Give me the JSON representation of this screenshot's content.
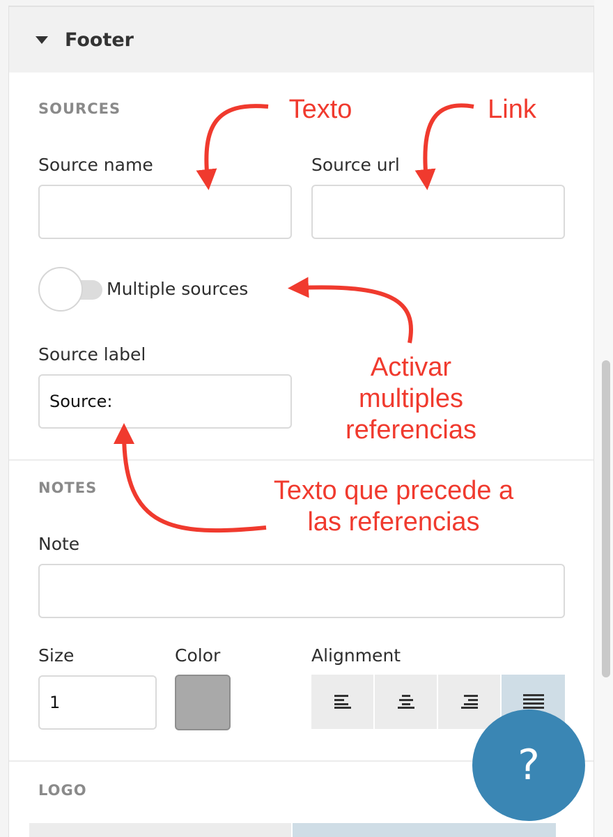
{
  "section": {
    "title": "Footer"
  },
  "sources": {
    "heading": "SOURCES",
    "source_name_label": "Source name",
    "source_name_value": "",
    "source_url_label": "Source url",
    "source_url_value": "",
    "multiple_sources_label": "Multiple sources",
    "multiple_sources_on": false,
    "source_label_label": "Source label",
    "source_label_value": "Source:"
  },
  "notes": {
    "heading": "NOTES",
    "note_label": "Note",
    "note_value": "",
    "size_label": "Size",
    "size_value": "1",
    "color_label": "Color",
    "color_value": "#a9a9a9",
    "alignment_label": "Alignment",
    "alignment_options": [
      "align-left-icon",
      "align-center-icon",
      "align-right-icon",
      "align-justify-icon"
    ],
    "alignment_selected": "align-justify-icon"
  },
  "logo": {
    "heading": "LOGO"
  },
  "help": {
    "label": "?"
  },
  "annotations": {
    "texto": "Texto",
    "link": "Link",
    "activar_line1": "Activar",
    "activar_line2": "multiples",
    "activar_line3": "referencias",
    "precede_line1": "Texto que precede a",
    "precede_line2": "las referencias",
    "color": "#f03a2e"
  }
}
